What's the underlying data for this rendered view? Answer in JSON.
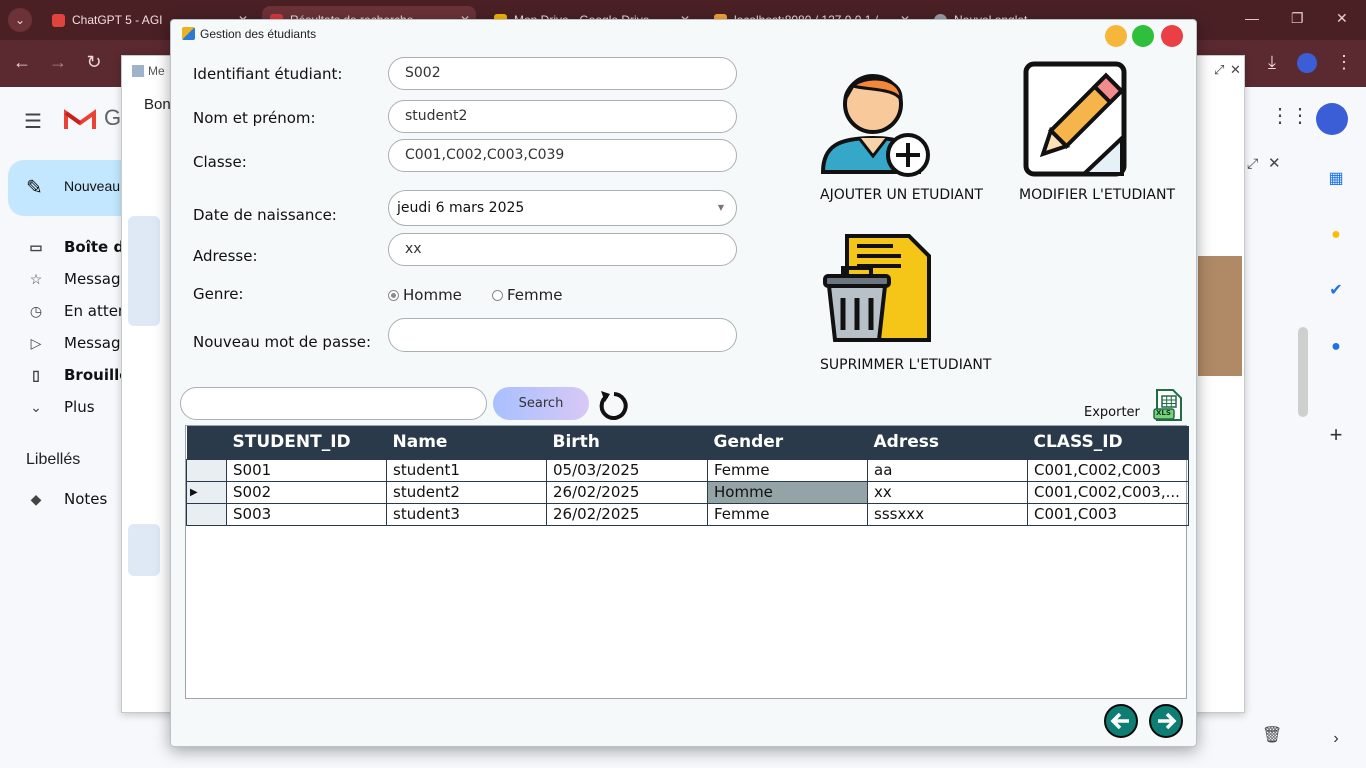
{
  "browser": {
    "tabs": [
      {
        "label": "ChatGPT 5 - AGI",
        "color": "#e0443c"
      },
      {
        "label": "Résultats de recherche",
        "color": "#d33b3b"
      },
      {
        "label": "Mon Drive - Google Drive",
        "color": "#f4b400"
      },
      {
        "label": "localhost:8080 / 127.0.0.1 / ...",
        "color": "#f2a33a"
      },
      {
        "label": "Nouvel onglet",
        "color": "#9aa0a6"
      }
    ]
  },
  "gmail": {
    "logo_text": "G",
    "compose_label": "Nouveau",
    "nav": [
      {
        "icon": "inbox-icon",
        "glyph": "▭",
        "label": "Boîte de",
        "bold": true
      },
      {
        "icon": "star-icon",
        "glyph": "☆",
        "label": "Message",
        "bold": false
      },
      {
        "icon": "clock-icon",
        "glyph": "◷",
        "label": "En attent",
        "bold": false
      },
      {
        "icon": "send-icon",
        "glyph": "▷",
        "label": "Message",
        "bold": false
      },
      {
        "icon": "draft-icon",
        "glyph": "▯",
        "label": "Brouillon",
        "bold": true
      },
      {
        "icon": "chevron-down-icon",
        "glyph": "⌄",
        "label": "Plus",
        "bold": false
      }
    ],
    "labels_heading": "Libellés",
    "label_notes": "Notes",
    "back_dialog_title": "Me",
    "back_dialog_text": "Bon"
  },
  "window": {
    "title": "Gestion des étudiants",
    "form": {
      "id_label": "Identifiant étudiant:",
      "id_value": "S002",
      "name_label": "Nom et prénom:",
      "name_value": "student2",
      "class_label": "Classe:",
      "class_value": "C001,C002,C003,C039",
      "birth_label": "Date de naissance:",
      "birth_value": "jeudi 6 mars 2025",
      "address_label": "Adresse:",
      "address_value": "xx",
      "gender_label": "Genre:",
      "gender_male": "Homme",
      "gender_female": "Femme",
      "gender_selected": "Homme",
      "password_label": "Nouveau mot de passe:",
      "password_value": ""
    },
    "actions": {
      "add": "AJOUTER UN ETUDIANT",
      "edit": "MODIFIER L'ETUDIANT",
      "delete": "SUPRIMMER L'ETUDIANT"
    },
    "search": {
      "value": "",
      "button": "Search"
    },
    "export_label": "Exporter",
    "export_icon_text": "XLS",
    "table": {
      "columns": [
        "STUDENT_ID",
        "Name",
        "Birth",
        "Gender",
        "Adress",
        "CLASS_ID"
      ],
      "rows": [
        [
          "S001",
          "student1",
          "05/03/2025",
          "Femme",
          "aa",
          "C001,C002,C003"
        ],
        [
          "S002",
          "student2",
          "26/02/2025",
          "Homme",
          "xx",
          "C001,C002,C003,..."
        ],
        [
          "S003",
          "student3",
          "26/02/2025",
          "Femme",
          "sssxxx",
          "C001,C003"
        ]
      ]
    }
  }
}
